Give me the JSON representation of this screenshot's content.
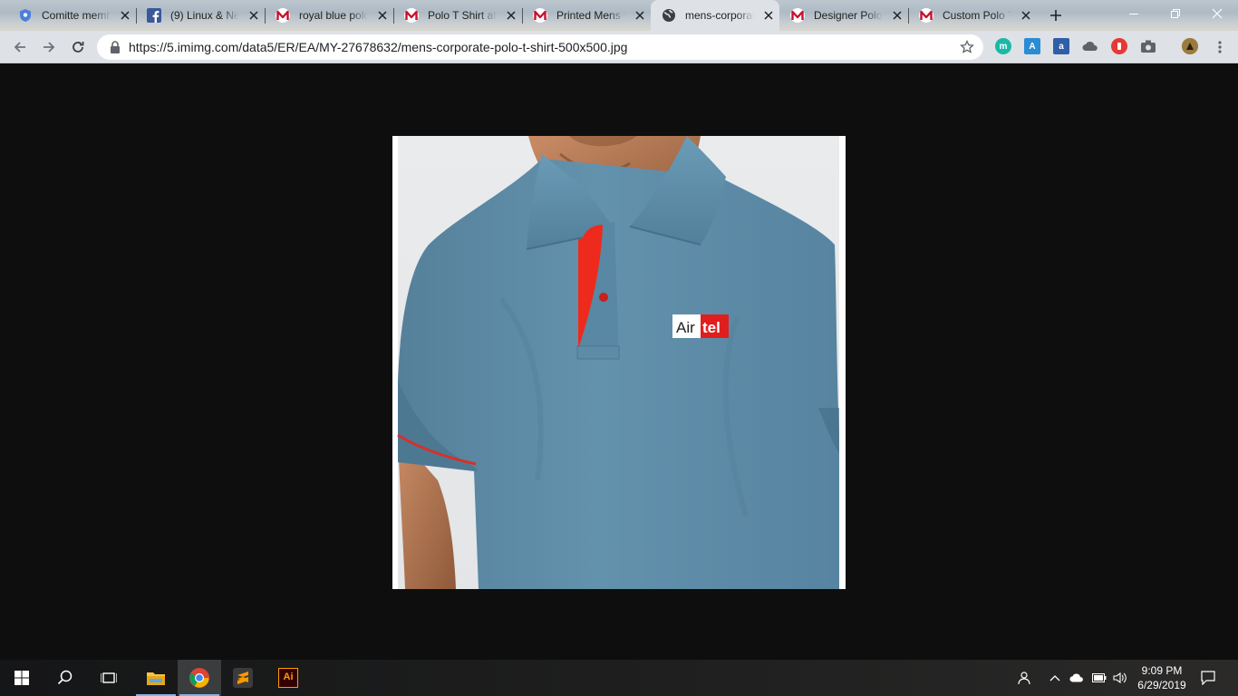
{
  "browser": {
    "tabs": [
      {
        "title": "Comitte memb",
        "icon": "shield-icon",
        "active": false
      },
      {
        "title": "(9) Linux & Ne",
        "icon": "facebook-icon",
        "active": false
      },
      {
        "title": "royal blue polo",
        "icon": "indiamart-icon",
        "active": false
      },
      {
        "title": "Polo T Shirt at",
        "icon": "indiamart-icon",
        "active": false
      },
      {
        "title": "Printed Mens C",
        "icon": "indiamart-icon",
        "active": false
      },
      {
        "title": "mens-corporat",
        "icon": "globe-icon",
        "active": true
      },
      {
        "title": "Designer Polo",
        "icon": "indiamart-icon",
        "active": false
      },
      {
        "title": "Custom Polo T",
        "icon": "indiamart-icon",
        "active": false
      }
    ],
    "address_bar": {
      "url": "https://5.imimg.com/data5/ER/EA/MY-27678632/mens-corporate-polo-t-shirt-500x500.jpg"
    },
    "extensions": [
      "m-extension-icon",
      "translate-extension-icon",
      "amazon-assistant-icon",
      "cloud-extension-icon",
      "adblock-icon",
      "camera-extension-icon"
    ]
  },
  "image": {
    "subject": "mens-corporate-polo-t-shirt",
    "logo_text_left": "Air",
    "logo_text_right": "tel",
    "colors": {
      "shirt": "#5e8ca6",
      "placket": "#ee2a1c",
      "logo_red": "#e01e1e"
    }
  },
  "taskbar": {
    "apps": [
      "windows-start-icon",
      "search-icon",
      "task-view-icon",
      "file-explorer-icon",
      "chrome-icon",
      "sublime-text-icon",
      "illustrator-icon"
    ],
    "illustrator_label": "Ai",
    "clock": {
      "time": "9:09 PM",
      "date": "6/29/2019"
    }
  }
}
